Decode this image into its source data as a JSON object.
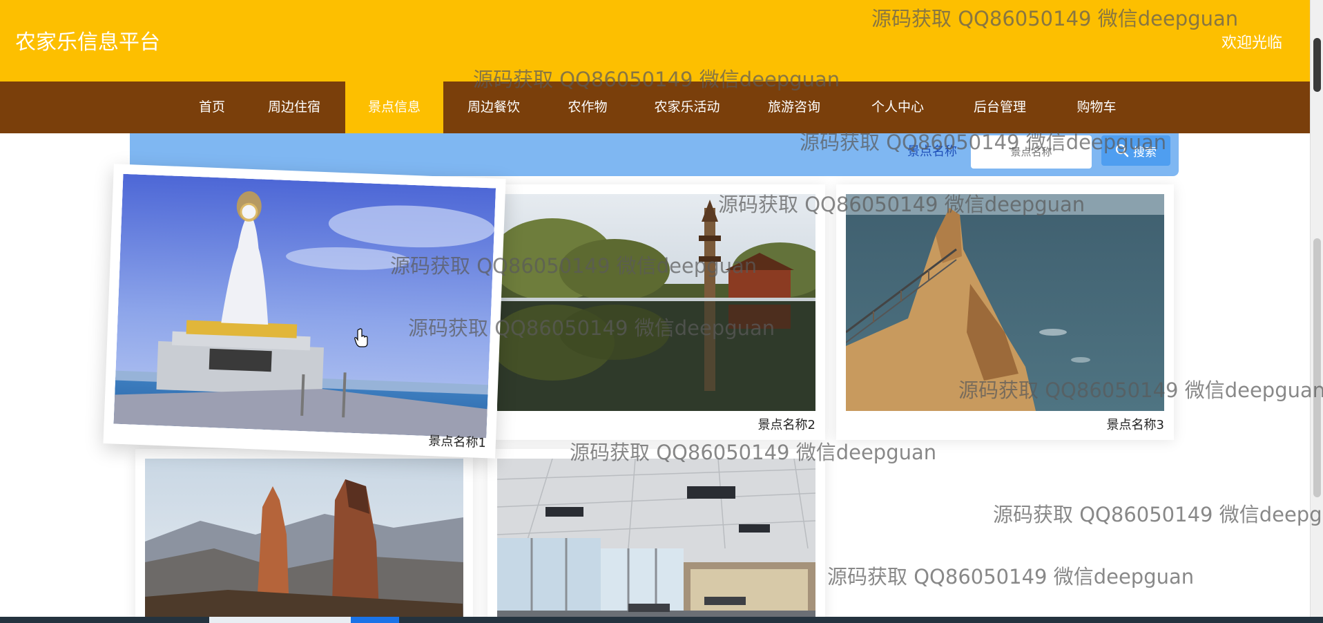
{
  "header": {
    "site_title": "农家乐信息平台",
    "welcome": "欢迎光临"
  },
  "nav": {
    "items": [
      "首页",
      "周边住宿",
      "景点信息",
      "周边餐饮",
      "农作物",
      "农家乐活动",
      "旅游咨询",
      "个人中心",
      "后台管理",
      "购物车"
    ],
    "active": "景点信息"
  },
  "search": {
    "label": "景点名称",
    "placeholder": "景点名称",
    "button_label": "搜索"
  },
  "cards": [
    {
      "caption": "景点名称1",
      "image": "guanyin-statue-seaside"
    },
    {
      "caption": "景点名称2",
      "image": "pagoda-lake-reflection"
    },
    {
      "caption": "景点名称3",
      "image": "sea-cliff-staircase"
    },
    {
      "caption": "",
      "image": "rock-pillars-mountain"
    },
    {
      "caption": "",
      "image": "office-interior"
    }
  ],
  "watermark": "源码获取 QQ86050149 微信deepguan",
  "icons": {
    "search": "search-icon",
    "cursor": "hand-cursor-icon"
  },
  "colors": {
    "header_bg": "#fdbf00",
    "nav_bg": "#7a3f0b",
    "nav_active_bg": "#fdbf00",
    "search_strip_bg": "#7fb7f2",
    "search_button_bg": "#4f9ef0"
  }
}
